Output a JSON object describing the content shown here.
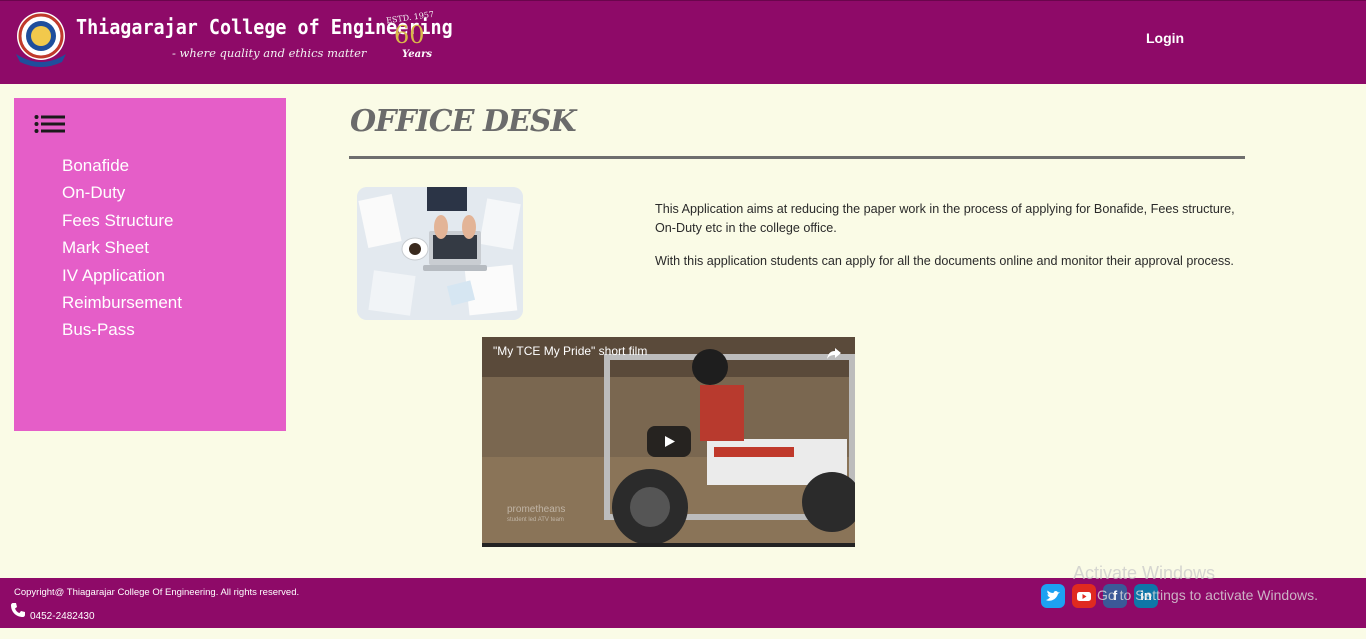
{
  "header": {
    "college_name": "Thiagarajar College of Engineering",
    "tagline": "- where quality and ethics matter",
    "badge_estd": "ESTD. 1957",
    "badge_number": "60",
    "badge_years": "Years",
    "login_label": "Login"
  },
  "sidebar": {
    "menu_icon": "hamburger-list-icon",
    "items": [
      {
        "label": "Bonafide"
      },
      {
        "label": "On-Duty"
      },
      {
        "label": "Fees Structure"
      },
      {
        "label": "Mark Sheet"
      },
      {
        "label": "IV Application"
      },
      {
        "label": "Reimbursement"
      },
      {
        "label": "Bus-Pass"
      }
    ]
  },
  "main": {
    "title": "OFFICE DESK",
    "paragraphs": [
      "This Application aims at reducing the paper work in the process of applying for Bonafide, Fees structure, On-Duty etc in the college office.",
      "With this application students can apply for all the documents online and monitor their approval process."
    ],
    "video": {
      "title": "\"My TCE My Pride\" short film",
      "watermark_line1": "prometheans",
      "watermark_line2": "student led ATV team"
    }
  },
  "footer": {
    "copyright": "Copyright@ Thiagarajar College Of Engineering. All rights reserved.",
    "phone": "0452-2482430",
    "social": [
      "twitter-icon",
      "youtube-icon",
      "facebook-icon",
      "linkedin-icon"
    ]
  },
  "watermark": {
    "line1": "Activate Windows",
    "line2": "Go to Settings to activate Windows."
  },
  "colors": {
    "brand": "#8e0a68",
    "sidebar": "#e55ec8",
    "page_bg": "#fafbe6"
  }
}
